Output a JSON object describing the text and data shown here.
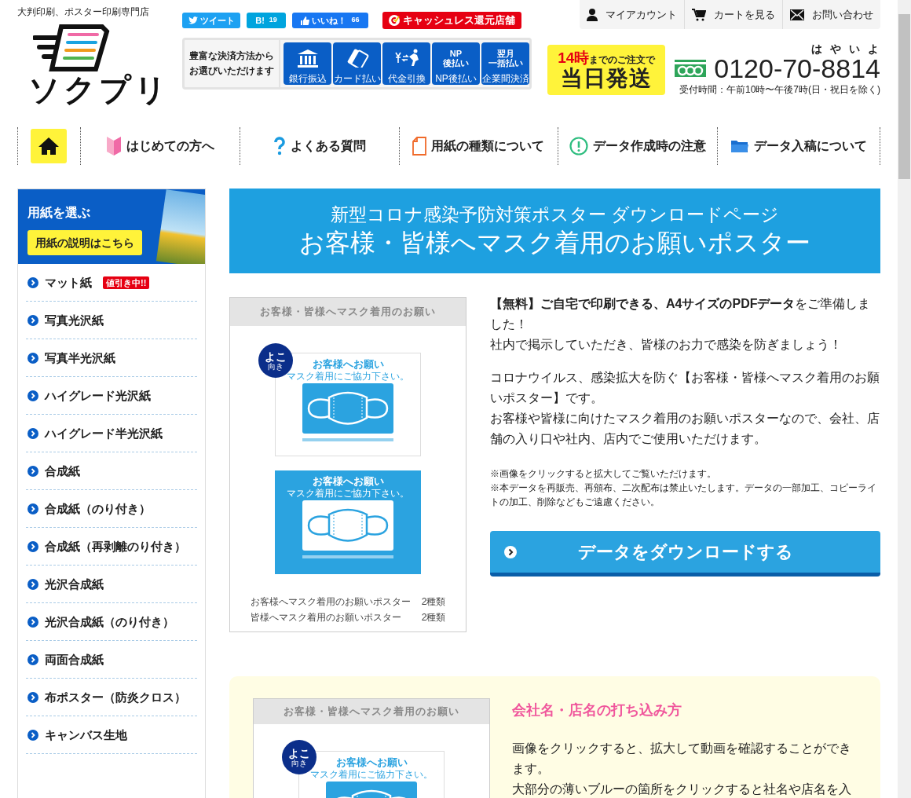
{
  "header": {
    "tagline": "大判印刷、ポスター印刷専門店",
    "logo_text": "ソクプリ",
    "social": [
      {
        "kind": "tweet",
        "label": "ツイート"
      },
      {
        "kind": "hatena",
        "label": "B!",
        "count": "19"
      },
      {
        "kind": "like",
        "label": "いいね！",
        "count": "66"
      }
    ],
    "cashless": "キャッシュレス還元店舗",
    "account_links": [
      {
        "kind": "user",
        "label": "マイアカウント"
      },
      {
        "kind": "cart",
        "label": "カートを見る"
      },
      {
        "kind": "mail",
        "label": "お問い合わせ"
      }
    ],
    "payment": {
      "lead": [
        "豊富な決済方法から",
        "お選びいただけます"
      ],
      "methods": [
        {
          "kind": "bank",
          "label": "銀行振込"
        },
        {
          "kind": "card",
          "label": "カード払い"
        },
        {
          "kind": "cod",
          "label": "代金引換"
        },
        {
          "kind": "text",
          "icon_text": [
            "NP",
            "後払い"
          ],
          "label": "NP後払い"
        },
        {
          "kind": "text",
          "icon_text": [
            "翌月",
            "一括払い"
          ],
          "label": "企業間決済"
        }
      ]
    },
    "shipping": {
      "hour": "14時",
      "rest": "までのご注文で",
      "main": "当日発送"
    },
    "phone": {
      "ruby": "はやいよ",
      "number": "0120-70-8814",
      "hours": "受付時間：午前10時〜午後7時(日・祝日を除く)"
    }
  },
  "nav": [
    {
      "kind": "home"
    },
    {
      "kind": "beginner",
      "label": "はじめての方へ"
    },
    {
      "kind": "faq",
      "label": "よくある質問"
    },
    {
      "kind": "paper",
      "label": "用紙の種類について"
    },
    {
      "kind": "warning",
      "label": "データ作成時の注意"
    },
    {
      "kind": "folder",
      "label": "データ入稿について"
    }
  ],
  "sidebar": {
    "title": "用紙を選ぶ",
    "button": "用紙の説明はこちら",
    "items": [
      {
        "label": "マット紙",
        "badge": "値引き中!!"
      },
      {
        "label": "写真光沢紙"
      },
      {
        "label": "写真半光沢紙"
      },
      {
        "label": "ハイグレード光沢紙"
      },
      {
        "label": "ハイグレード半光沢紙"
      },
      {
        "label": "合成紙"
      },
      {
        "label": "合成紙（のり付き）"
      },
      {
        "label": "合成紙（再剥離のり付き）"
      },
      {
        "label": "光沢合成紙"
      },
      {
        "label": "光沢合成紙（のり付き）"
      },
      {
        "label": "両面合成紙"
      },
      {
        "label": "布ポスター（防炎クロス）"
      },
      {
        "label": "キャンバス生地"
      }
    ]
  },
  "banner": {
    "subtitle": "新型コロナ感染予防対策ポスター ダウンロードページ",
    "title": "お客様・皆様へマスク着用のお願いポスター"
  },
  "preview": {
    "header": "お客様・皆様へマスク着用のお願い",
    "badge": "よこ",
    "badge_sub": "向き",
    "posters": [
      {
        "kind": "outline",
        "title": "お客様へお願い",
        "sub": "マスク着用にご協力下さい。"
      },
      {
        "kind": "filled",
        "title": "お客様へお願い",
        "sub": "マスク着用にご協力下さい。"
      }
    ],
    "list": [
      {
        "name": "お客様へマスク着用のお願いポスター",
        "count": "2種類"
      },
      {
        "name": "皆様へマスク着用のお願いポスター",
        "count": "2種類"
      }
    ]
  },
  "intro": [
    [
      "**【無料】ご自宅で印刷できる、A4サイズのPDFデータ**をご準備しました！",
      "社内で掲示していただき、皆様のお力で感染を防ぎましょう！"
    ],
    [
      "コロナウイルス、感染拡大を防ぐ【お客様・皆様へマスク着用のお願いポスター】です。",
      "お客様や皆様に向けたマスク着用のお願いポスターなので、会社、店舗の入り口や社内、店内でご使用いただけます。"
    ]
  ],
  "notes": [
    "※画像をクリックすると拡大してご覧いただけます。",
    "※本データを再販売、再頒布、二次配布は禁止いたします。データの一部加工、コピーライトの加工、削除などもご遠慮ください。"
  ],
  "download_button": "データをダウンロードする",
  "howto": {
    "preview_header": "お客様・皆様へマスク着用のお願い",
    "badge": "よこ",
    "badge_sub": "向き",
    "poster": {
      "kind": "outline",
      "title": "お客様へお願い",
      "sub": "マスク着用にご協力下さい。"
    },
    "title": "会社名・店名の打ち込み方",
    "text": [
      "画像をクリックすると、拡大して動画を確認することができます。",
      "大部分の薄いブルーの箇所をクリックすると社名や店名を入"
    ]
  }
}
